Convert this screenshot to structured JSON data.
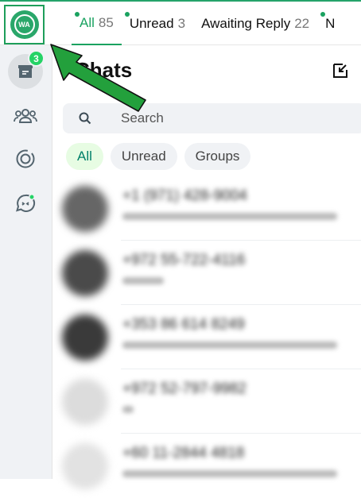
{
  "topbar": {
    "tabs": [
      {
        "label": "All",
        "count": "85",
        "active": true
      },
      {
        "label": "Unread",
        "count": "3",
        "active": false
      },
      {
        "label": "Awaiting Reply",
        "count": "22",
        "active": false
      },
      {
        "label": "N",
        "count": "",
        "active": false
      }
    ]
  },
  "extension": {
    "logo_text": "WA",
    "icon": "wa-extension-logo-icon"
  },
  "sidebar": {
    "items": [
      {
        "name": "chats",
        "icon": "archive-icon",
        "badge": "3"
      },
      {
        "name": "communities",
        "icon": "people-icon"
      },
      {
        "name": "status",
        "icon": "status-ring-icon"
      },
      {
        "name": "channels",
        "icon": "chat-bubble-icon"
      }
    ]
  },
  "main": {
    "title": "Chats",
    "search_placeholder": "Search",
    "filters": [
      "All",
      "Unread",
      "Groups"
    ]
  },
  "chats": [
    {
      "name": "+1 (971) 428-9004"
    },
    {
      "name": "+972 55-722-4116"
    },
    {
      "name": "+353 86 614 8249"
    },
    {
      "name": "+972 52-797-9982"
    },
    {
      "name": "+60 11-2844 4818"
    }
  ],
  "colors": {
    "accent": "#1aa260",
    "badge": "#25d366",
    "arrow": "#23a03c",
    "sidebar": "#f0f2f5"
  }
}
